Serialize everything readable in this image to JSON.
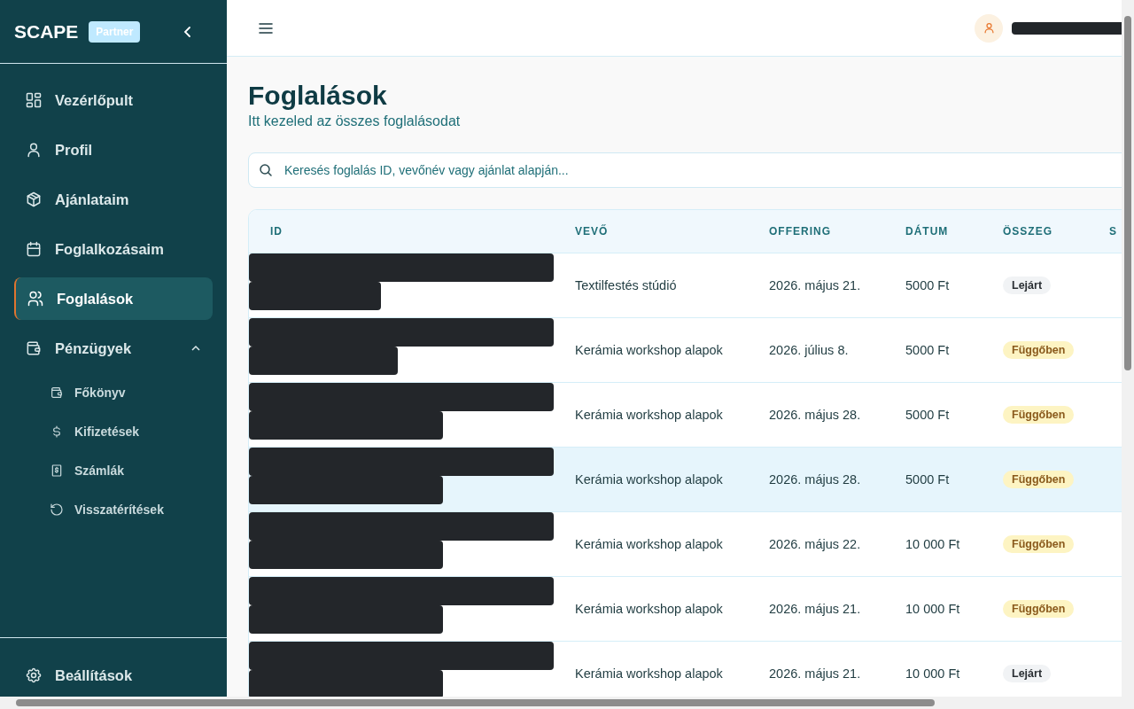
{
  "sidebar": {
    "logo": "SCAPE",
    "badge": "Partner",
    "items": [
      {
        "label": "Vezérlőpult",
        "selected": false
      },
      {
        "label": "Profil",
        "selected": false
      },
      {
        "label": "Ajánlataim",
        "selected": false
      },
      {
        "label": "Foglalkozásaim",
        "selected": false
      },
      {
        "label": "Foglalások",
        "selected": true
      },
      {
        "label": "Pénzügyek",
        "selected": false,
        "expanded": true,
        "children": [
          {
            "label": "Főkönyv"
          },
          {
            "label": "Kifizetések"
          },
          {
            "label": "Számlák"
          },
          {
            "label": "Visszatérítések"
          }
        ]
      }
    ],
    "footer": {
      "label": "Beállítások"
    }
  },
  "page": {
    "title": "Foglalások",
    "subtitle": "Itt kezeled az összes foglalásodat"
  },
  "search": {
    "placeholder": "Keresés foglalás ID, vevőnév vagy ajánlat alapján..."
  },
  "table": {
    "columns": [
      "ID",
      "VEVŐ",
      "OFFERING",
      "DÁTUM",
      "ÖSSZEG",
      "S"
    ],
    "rows": [
      {
        "offering": "Textilfestés stúdió",
        "date": "2026. május 21.",
        "amount": "5000 Ft",
        "status": "Lejárt",
        "kind": "expired",
        "selected": false
      },
      {
        "offering": "Kerámia workshop alapok",
        "date": "2026. július 8.",
        "amount": "5000 Ft",
        "status": "Függőben",
        "kind": "pending",
        "selected": false
      },
      {
        "offering": "Kerámia workshop alapok",
        "date": "2026. május 28.",
        "amount": "5000 Ft",
        "status": "Függőben",
        "kind": "pending",
        "selected": false
      },
      {
        "offering": "Kerámia workshop alapok",
        "date": "2026. május 28.",
        "amount": "5000 Ft",
        "status": "Függőben",
        "kind": "pending",
        "selected": true
      },
      {
        "offering": "Kerámia workshop alapok",
        "date": "2026. május 22.",
        "amount": "10 000 Ft",
        "status": "Függőben",
        "kind": "pending",
        "selected": false
      },
      {
        "offering": "Kerámia workshop alapok",
        "date": "2026. május 21.",
        "amount": "10 000 Ft",
        "status": "Függőben",
        "kind": "pending",
        "selected": false
      },
      {
        "offering": "Kerámia workshop alapok",
        "date": "2026. május 21.",
        "amount": "10 000 Ft",
        "status": "Lejárt",
        "kind": "expired",
        "selected": false
      }
    ]
  }
}
